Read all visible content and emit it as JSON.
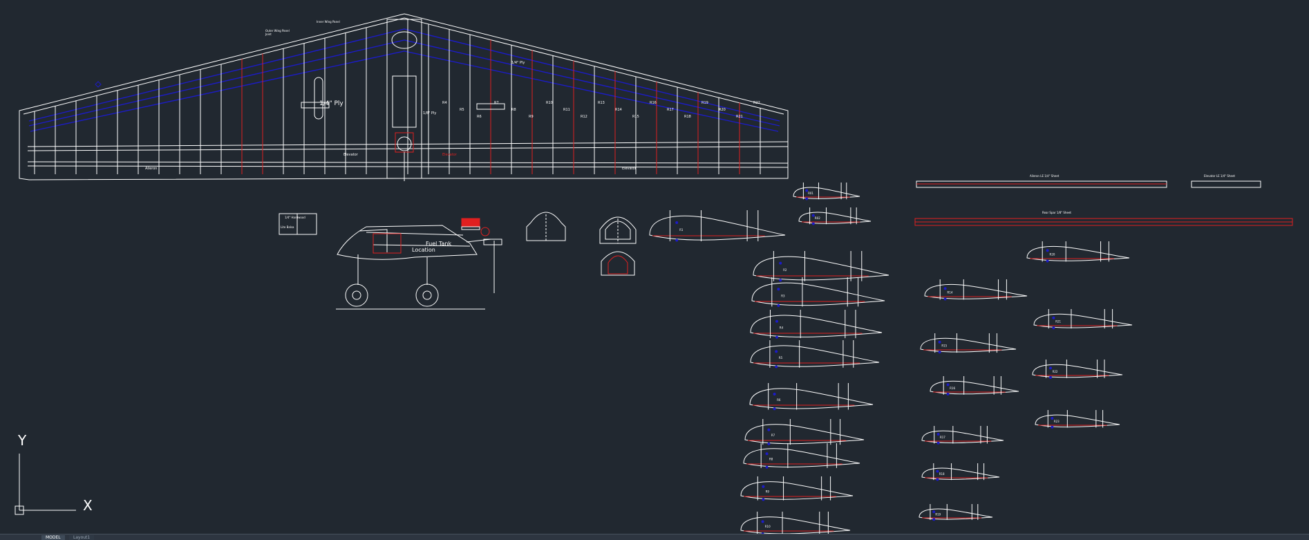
{
  "colors": {
    "background": "#212830",
    "line_white": "#ffffff",
    "line_blue": "#1c1cc8",
    "line_red": "#e02020"
  },
  "statusbar": {
    "model_tab": "MODEL",
    "layout_tab": "Layout1"
  },
  "wing": {
    "callout_1": "Outer Wing Panel",
    "callout_1b": "Joint",
    "callout_2": "Inner Wing Panel",
    "label_center": "1/4\" Ply",
    "label_ply": "1/8\" Ply",
    "label_elevon": "Elevator",
    "label_aileron": "Aileron",
    "label_rudder": "Elevator",
    "rib_labels": [
      "R4",
      "R5",
      "R6",
      "R7",
      "R8",
      "R9",
      "R10",
      "R11",
      "R12",
      "R13",
      "R14",
      "R15",
      "R16",
      "R17",
      "R18",
      "R19",
      "R20",
      "R21",
      "R22"
    ]
  },
  "fuselage": {
    "tank_label": "Fuel Tank",
    "tank_label_2": "Location",
    "box_line_1": "1/4\" Hardwood",
    "box_line_2": "Lite Balsa"
  },
  "sheets": {
    "aileron_sheet": "Aileron LE 1/4\" Sheet",
    "elevator_sheet": "Elevator LE 1/4\" Sheet",
    "rear_sheet": "Rear Spar 1/8\" Sheet"
  },
  "ribs": {
    "col1": [
      "R1",
      "R2",
      "R3",
      "R4",
      "R5",
      "R6",
      "R7",
      "R8",
      "R9",
      "R10",
      "R11",
      "R12",
      "R13"
    ],
    "col2": [
      "R14",
      "R15",
      "R16",
      "R17",
      "R18",
      "R19"
    ],
    "col3": [
      "R20",
      "R21",
      "R22",
      "R23"
    ],
    "small": [
      "R01",
      "R02"
    ]
  },
  "ucs": {
    "x_label": "X",
    "y_label": "Y"
  }
}
